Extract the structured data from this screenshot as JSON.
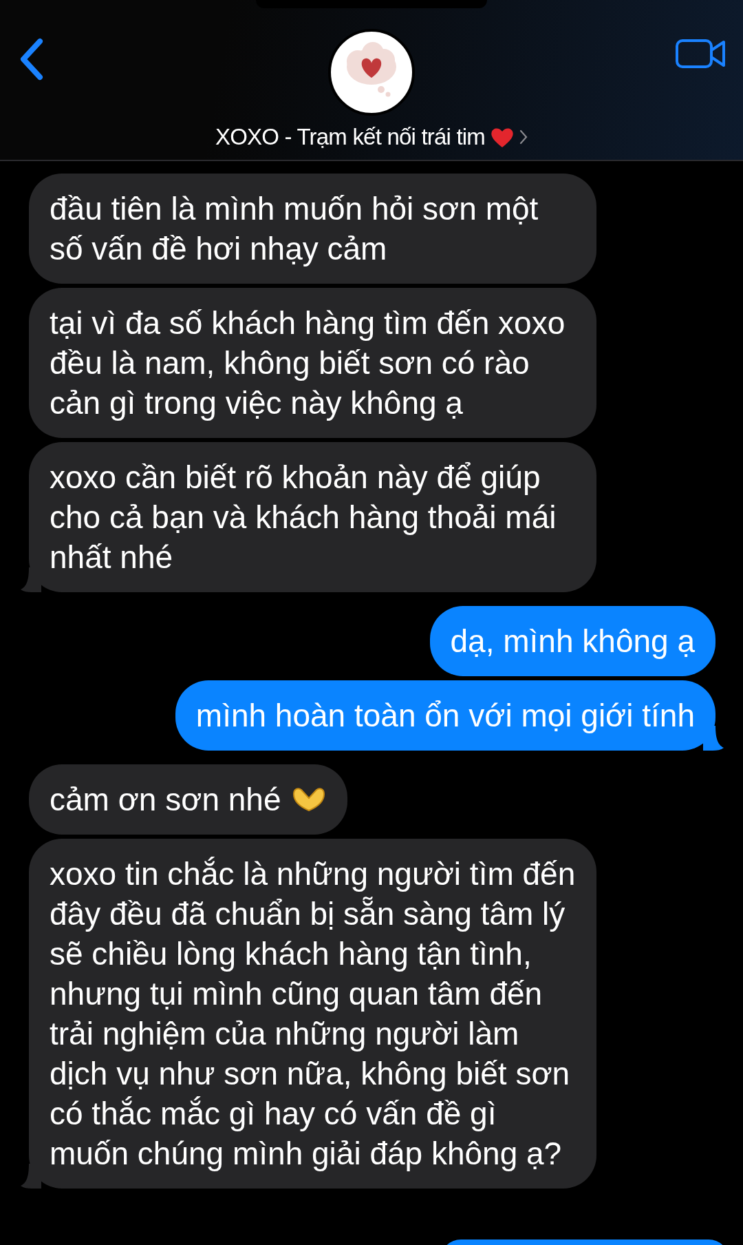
{
  "header": {
    "contact_name": "XOXO - Trạm kết nối trái tim"
  },
  "messages": [
    {
      "kind": "incoming",
      "text": "đầu tiên là mình muốn hỏi sơn một số vấn đề hơi nhạy cảm",
      "tail": false
    },
    {
      "kind": "incoming",
      "text": "tại vì đa số khách hàng tìm đến xoxo đều là nam, không biết sơn có rào cản gì trong việc này không ạ",
      "tail": false
    },
    {
      "kind": "incoming",
      "text": "xoxo cần biết rõ khoản này để giúp cho cả bạn và khách hàng thoải mái nhất nhé",
      "tail": true
    },
    {
      "kind": "outgoing",
      "text": "dạ, mình không ạ",
      "tail": false
    },
    {
      "kind": "outgoing",
      "text": "mình hoàn toàn ổn với mọi giới tính",
      "tail": true
    },
    {
      "kind": "incoming",
      "text": "cảm ơn sơn nhé",
      "tail": false,
      "emoji": true
    },
    {
      "kind": "incoming",
      "text": "xoxo tin chắc là những người tìm đến đây đều đã chuẩn bị sẵn sàng tâm lý sẽ chiều lòng khách hàng tận tình, nhưng tụi mình cũng quan tâm đến trải nghiệm của những người làm dịch vụ như sơn nữa, không biết sơn có thắc mắc gì hay có vấn đề gì muốn chúng mình giải đáp không ạ?",
      "tail": true
    }
  ]
}
